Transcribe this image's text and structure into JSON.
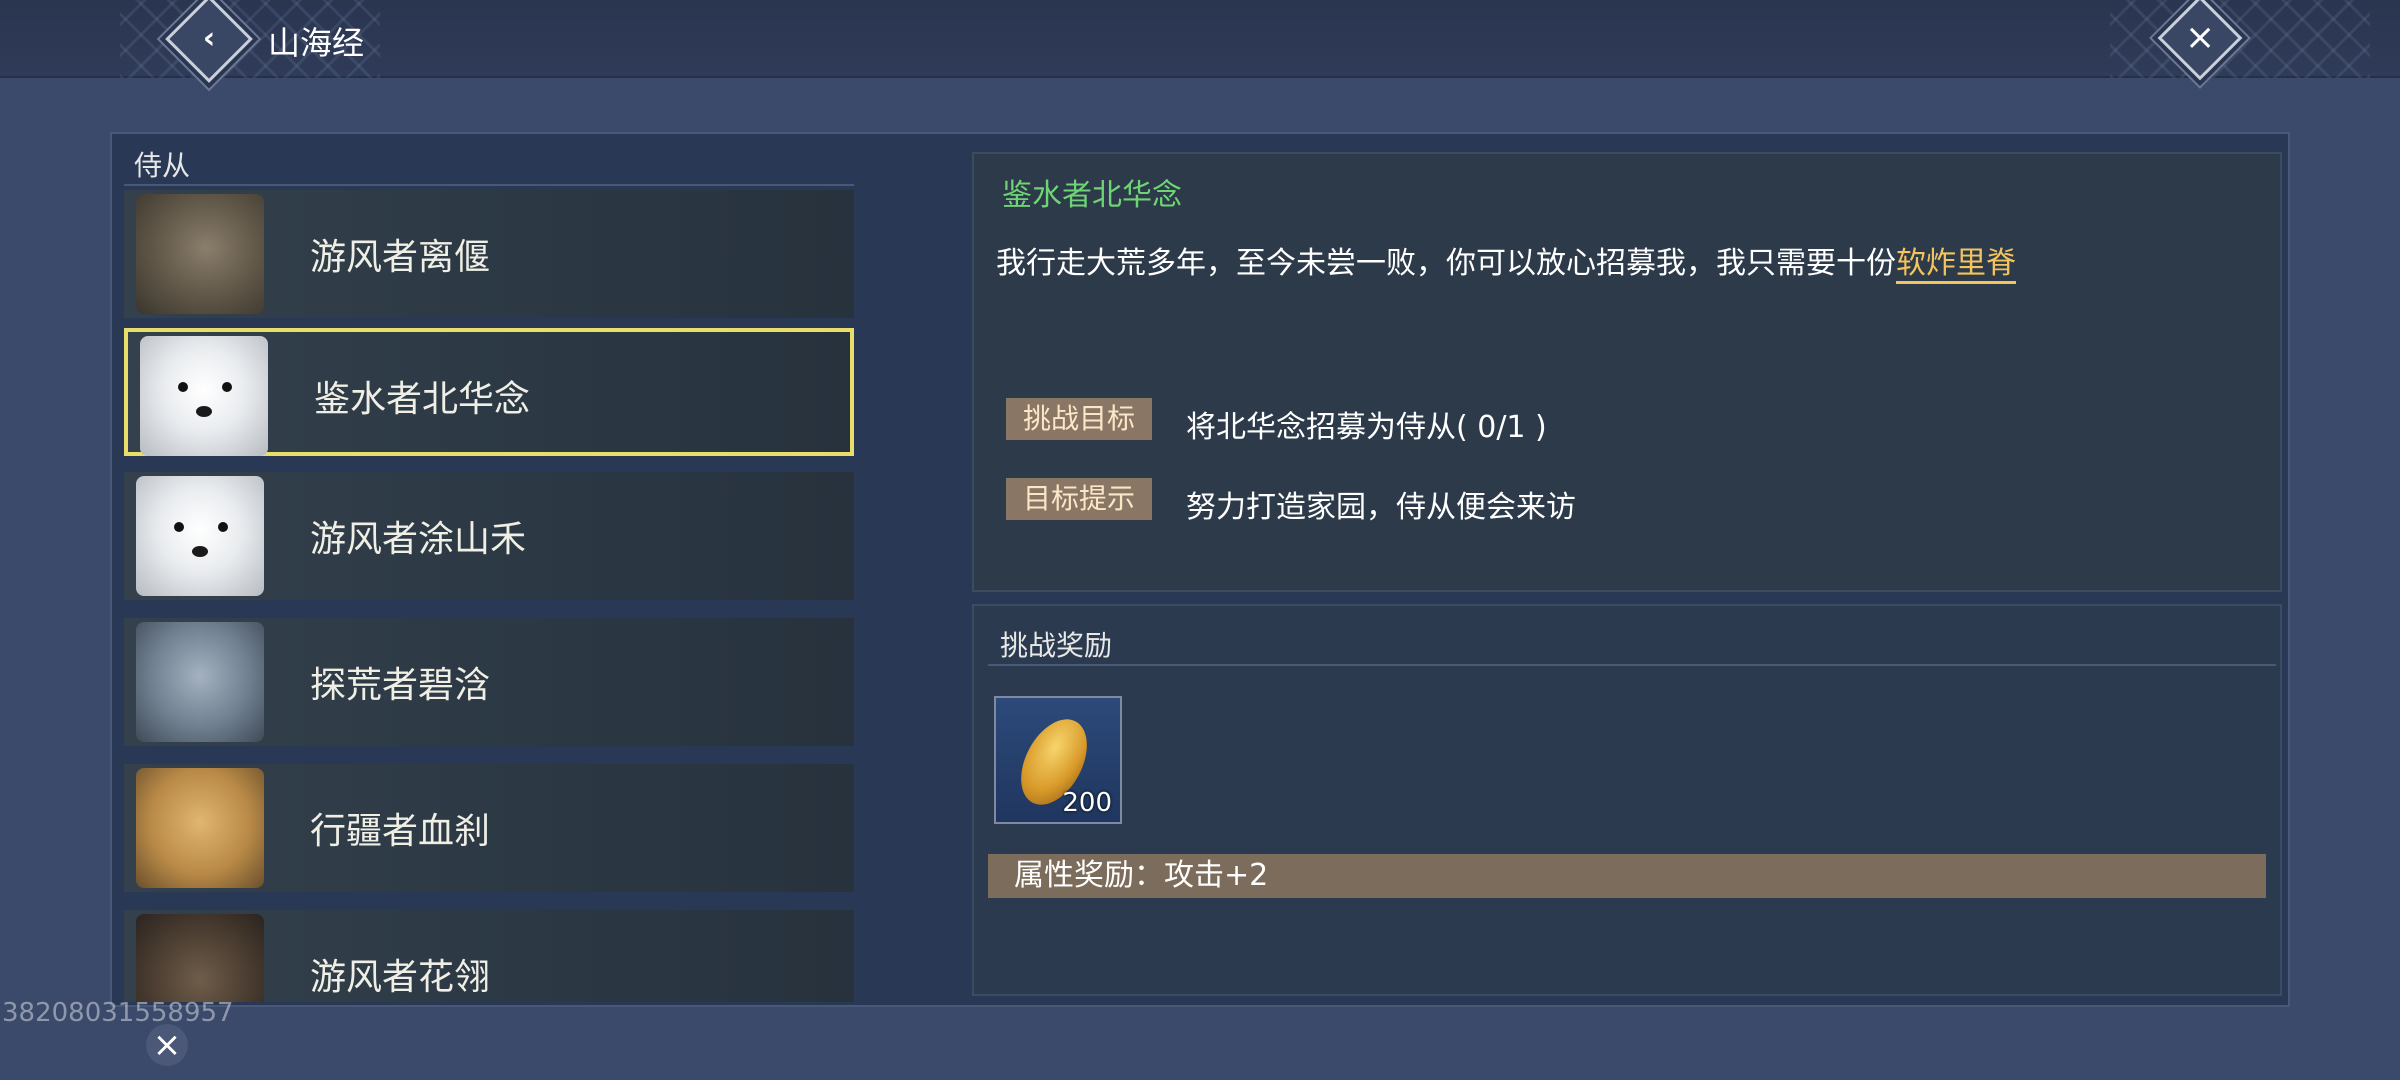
{
  "header": {
    "title": "山海经",
    "back_icon": "back-diamond-icon",
    "close_icon": "close-diamond-icon"
  },
  "left_panel": {
    "section_label": "侍从",
    "items": [
      {
        "name": "游风者离偃",
        "portrait": "rhino"
      },
      {
        "name": "鉴水者北华念",
        "portrait": "fox",
        "selected": true
      },
      {
        "name": "游风者涂山禾",
        "portrait": "fox"
      },
      {
        "name": "探荒者碧浛",
        "portrait": "shark"
      },
      {
        "name": "行疆者血刹",
        "portrait": "boar"
      },
      {
        "name": "游风者花翎",
        "portrait": "eagle"
      }
    ]
  },
  "detail": {
    "npc_name": "鉴水者北华念",
    "description": "我行走大荒多年，至今未尝一败，你可以放心招募我，我只需要十份",
    "description_highlight": "软炸里脊",
    "challenge_tag": "挑战目标",
    "challenge_text": "将北华念招募为侍从( 0/1 )",
    "hint_tag": "目标提示",
    "hint_text": "努力打造家园，侍从便会来访"
  },
  "rewards": {
    "title": "挑战奖励",
    "items": [
      {
        "icon": "golden-seed-icon",
        "count": "200"
      }
    ],
    "attribute": "属性奖励：攻击+2"
  },
  "overlay": {
    "uid": "38208031558957"
  },
  "colors": {
    "selected_border": "#e9de6a",
    "npc_name": "#6fd476",
    "highlight": "#f3c35d",
    "tag_bg": "#8a7664"
  }
}
